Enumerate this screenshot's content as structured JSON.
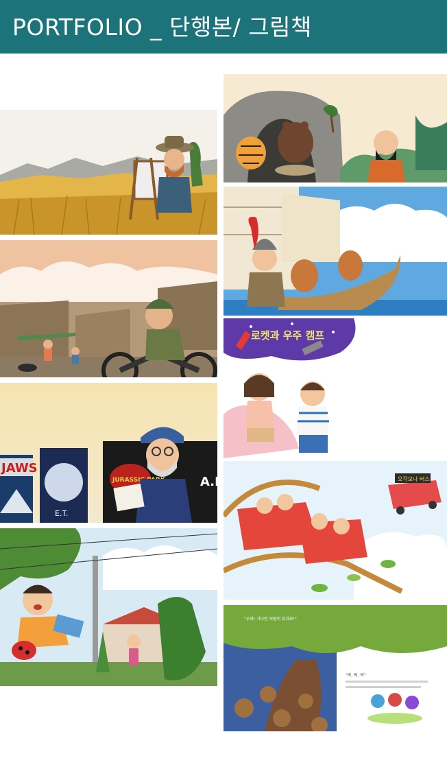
{
  "header": {
    "title": "PORTFOLIO _ 단행본/ 그림책"
  },
  "illustrations": {
    "van_gogh_wheat_field": {
      "icon": "painter-wheat-field-illustration"
    },
    "aviator_motorcycle": {
      "icon": "motorcycle-rider-illustration"
    },
    "director_posters": {
      "icon": "director-movie-posters-illustration",
      "poster_jaws": "JAWS",
      "poster_et": "E.T.",
      "poster_jurassic": "JURASSIC PARK",
      "poster_ai": "A.I"
    },
    "boy_ladybug": {
      "icon": "boy-ladybug-street-illustration"
    },
    "tiger_bear_cave": {
      "icon": "tiger-bear-cave-illustration"
    },
    "general_ship": {
      "icon": "general-turtle-ship-illustration"
    },
    "rocket_camp": {
      "icon": "children-rocket-camp-illustration",
      "banner_text": "로켓과 우주 캠프"
    },
    "roller_coaster": {
      "icon": "roller-coaster-family-illustration",
      "bus_sign": "오각보나 버스"
    },
    "tree_chestnuts": {
      "icon": "tree-chestnut-page-illustration",
      "page_text_top": "\"우와! 기다린 보람이 있네요!\"",
      "page_text_right": "\"박, 박, 박\""
    }
  },
  "colors": {
    "header_bg": "#1d737a",
    "header_text": "#ffffff"
  }
}
